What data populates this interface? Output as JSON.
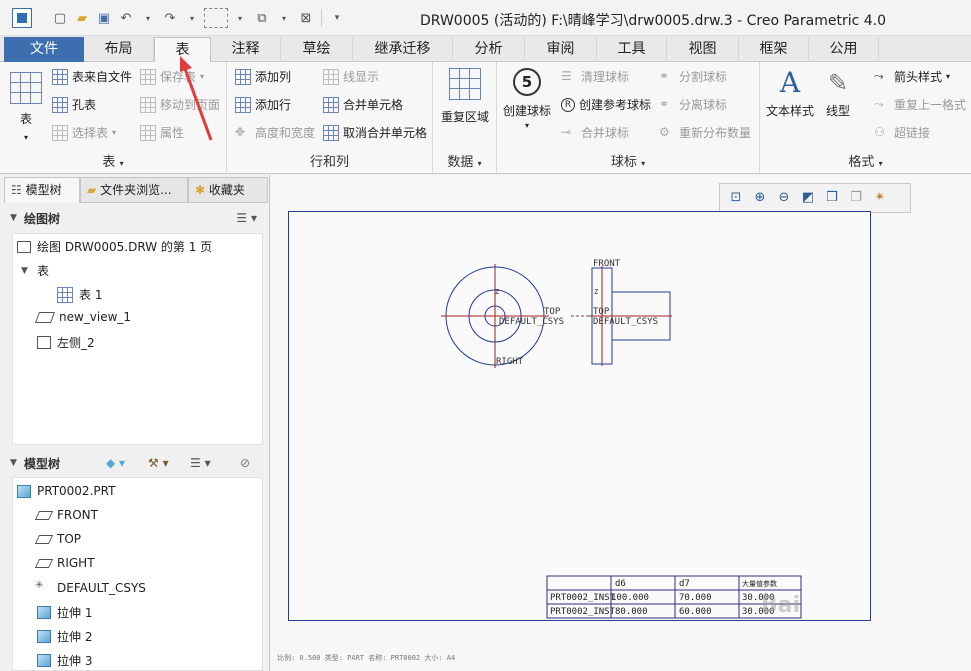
{
  "window": {
    "title": "DRW0005 (活动的) F:\\晴峰学习\\drw0005.drw.3 - Creo Parametric 4.0"
  },
  "tabs": [
    "文件",
    "布局",
    "表",
    "注释",
    "草绘",
    "继承迁移",
    "分析",
    "审阅",
    "工具",
    "视图",
    "框架",
    "公用"
  ],
  "ribbon": {
    "table_group": {
      "label": "表",
      "table_btn": "表",
      "from_file": "表来自文件",
      "hole_table": "孔表",
      "select_table": "选择表",
      "save_table": "保存表",
      "move_to_page": "移动到页面",
      "properties": "属性"
    },
    "rows_cols": {
      "label": "行和列",
      "add_column": "添加列",
      "add_row": "添加行",
      "height_width": "高度和宽度",
      "line_display": "线显示",
      "merge_cells": "合并单元格",
      "unmerge_cells": "取消合并单元格"
    },
    "data": {
      "label": "数据",
      "repeat_region": "重复区域"
    },
    "balloons": {
      "label": "球标",
      "create_balloon": "创建球标",
      "clear_balloon": "清理球标",
      "create_ref_balloon": "创建参考球标",
      "merge_balloon": "合并球标",
      "split_balloon": "分割球标",
      "split_balloon2": "分离球标",
      "redistribute_qty": "重新分布数量"
    },
    "format": {
      "label": "格式",
      "text_style": "文本样式",
      "line_style": "线型",
      "arrow_style": "箭头样式",
      "repeat_last_format": "重复上一格式",
      "hyperlink": "超链接"
    }
  },
  "panel": {
    "tabs": [
      "模型树",
      "文件夹浏览...",
      "收藏夹"
    ],
    "drawing_tree": {
      "header": "绘图树",
      "items": [
        "绘图 DRW0005.DRW 的第 1 页",
        "表",
        "表 1",
        "new_view_1",
        "左侧_2"
      ]
    },
    "model_tree": {
      "header": "模型树",
      "items": [
        "PRT0002.PRT",
        "FRONT",
        "TOP",
        "RIGHT",
        "DEFAULT_CSYS",
        "拉伸 1",
        "拉伸 2",
        "拉伸 3"
      ]
    }
  },
  "drawing": {
    "view1_labels": {
      "top": "TOP",
      "csys": "DEFAULT_CSYS",
      "right": "RIGHT",
      "z": "Z"
    },
    "view2_labels": {
      "front": "FRONT",
      "top": "TOP",
      "csys": "DEFAULT_CSYS",
      "z": "Z"
    },
    "table": {
      "headers": [
        "",
        "d6",
        "d7",
        "大量值参数"
      ],
      "rows": [
        [
          "PRT0002_INST",
          "100.000",
          "70.000",
          "30.000"
        ],
        [
          "PRT0002_INST",
          "80.000",
          "60.000",
          "30.000"
        ]
      ]
    },
    "status": "比例: 0.500  类型: PART  名称: PRT0002  大小: A4"
  },
  "watermark": "Bai"
}
